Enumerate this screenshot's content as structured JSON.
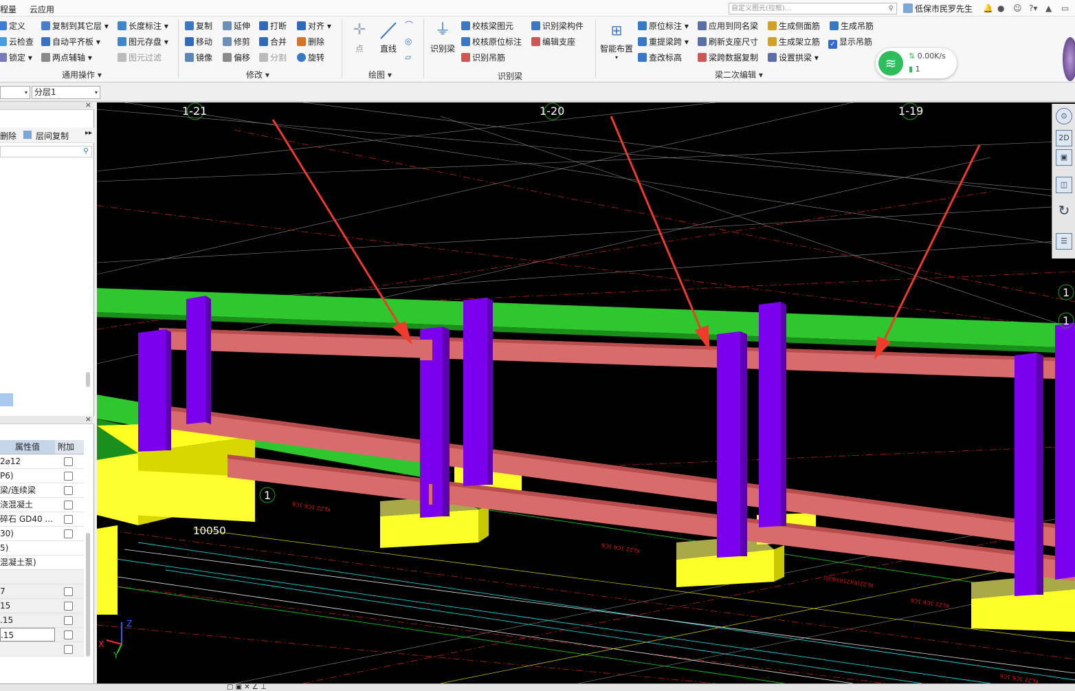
{
  "menu": {
    "item_left": "程量",
    "item_cloud": "云应用"
  },
  "search": {
    "text": "自定义图元(拉框)…"
  },
  "user": {
    "name": "低保市民罗先生"
  },
  "ribbon": {
    "col1": [
      "定义",
      "云检查",
      "锁定"
    ],
    "col2": [
      "复制到其它层",
      "自动平齐板",
      "两点辅轴"
    ],
    "col3": [
      "长度标注",
      "图元存盘",
      "图元过滤"
    ],
    "group_general": "通用操作",
    "modify": [
      "复制",
      "延伸",
      "打断",
      "对齐",
      "移动",
      "修剪",
      "合并",
      "删除",
      "镜像",
      "偏移",
      "分割",
      "旋转"
    ],
    "group_modify": "修改",
    "draw": {
      "point": "点",
      "line": "直线",
      "group": "绘图"
    },
    "recog": {
      "big": "识别梁",
      "items": [
        "校核梁图元",
        "校核原位标注",
        "识别吊筋",
        "识别梁构件",
        "编辑支座"
      ],
      "group": "识别梁"
    },
    "beam2": {
      "big": "智能布置",
      "items": [
        "原位标注",
        "应用到同名梁",
        "生成侧面筋",
        "生成吊筋",
        "重提梁跨",
        "刷新支座尺寸",
        "生成架立筋",
        "显示吊筋",
        "查改标高",
        "梁跨数据复制",
        "设置拱梁"
      ],
      "group": "梁二次编辑"
    }
  },
  "network": {
    "speed": "0.00K/s",
    "count": "1"
  },
  "floor": {
    "layer": "分层1"
  },
  "panel": {
    "tools": {
      "delete": "删除",
      "copy": "层间复制"
    },
    "header_value": "属性值",
    "header_extra": "附加",
    "rows": [
      "2⌀12",
      "P6)",
      "梁/连续梁",
      "浇混凝土",
      "碎石 GD40 ...",
      "30)",
      "5)",
      "混凝土泵)",
      "",
      "7",
      "15",
      ".15",
      ".15",
      ""
    ]
  },
  "viewport": {
    "axis_labels": [
      "1-21",
      "1-20",
      "1-19"
    ],
    "right_marks": [
      "1",
      "1"
    ],
    "mid_mark": "1",
    "dim_text": "10050",
    "axes": {
      "x": "X",
      "y": "Y",
      "z": "Z"
    }
  },
  "viewicons": {
    "twod": "2D"
  },
  "colors": {
    "column": "#7b00ee",
    "beam": "#d86c6c",
    "green_beam": "#2ec82e",
    "footing": "#f0f000",
    "arrow": "#ee3b2b"
  }
}
